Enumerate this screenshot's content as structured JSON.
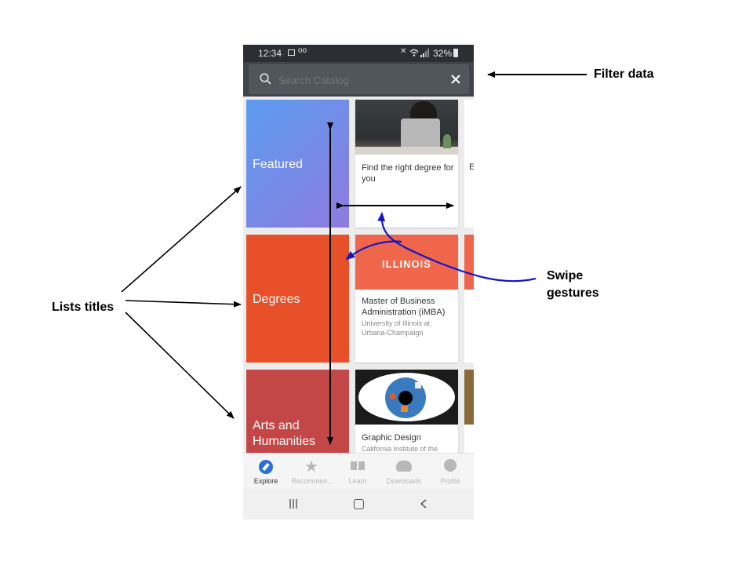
{
  "status_bar": {
    "time": "12:34",
    "battery": "32%"
  },
  "search": {
    "placeholder": "Search Catalog"
  },
  "rows": [
    {
      "title": "Featured",
      "color_start": "#5b9cf0",
      "color_end": "#8e7bdf",
      "card": {
        "title": "Find the right degree for you",
        "subtitle": ""
      }
    },
    {
      "title": "Degrees",
      "color": "#e8502a",
      "card": {
        "title": "Master of Business Administration (iMBA)",
        "subtitle": "University of Illinois at Urbana-Champaign",
        "image_text": "ILLINOIS",
        "image_color": "#f0664a"
      }
    },
    {
      "title": "Arts and Humanities",
      "color": "#c44747",
      "card": {
        "title": "Graphic Design",
        "subtitle": "California Institute of the"
      }
    }
  ],
  "bottom_nav": [
    {
      "label": "Explore",
      "icon": "compass-icon",
      "active": true
    },
    {
      "label": "Recommen...",
      "icon": "star-icon",
      "active": false
    },
    {
      "label": "Learn",
      "icon": "book-icon",
      "active": false
    },
    {
      "label": "Downloads",
      "icon": "cloud-download-icon",
      "active": false
    },
    {
      "label": "Profile",
      "icon": "person-icon",
      "active": false
    }
  ],
  "annotations": {
    "filter": "Filter data",
    "lists_titles": "Lists titles",
    "swipe": "Swipe gestures"
  },
  "colors": {
    "accent": "#2b6fd6",
    "annotation_arrow": "#000000",
    "gesture_arrow": "#1515c8"
  }
}
